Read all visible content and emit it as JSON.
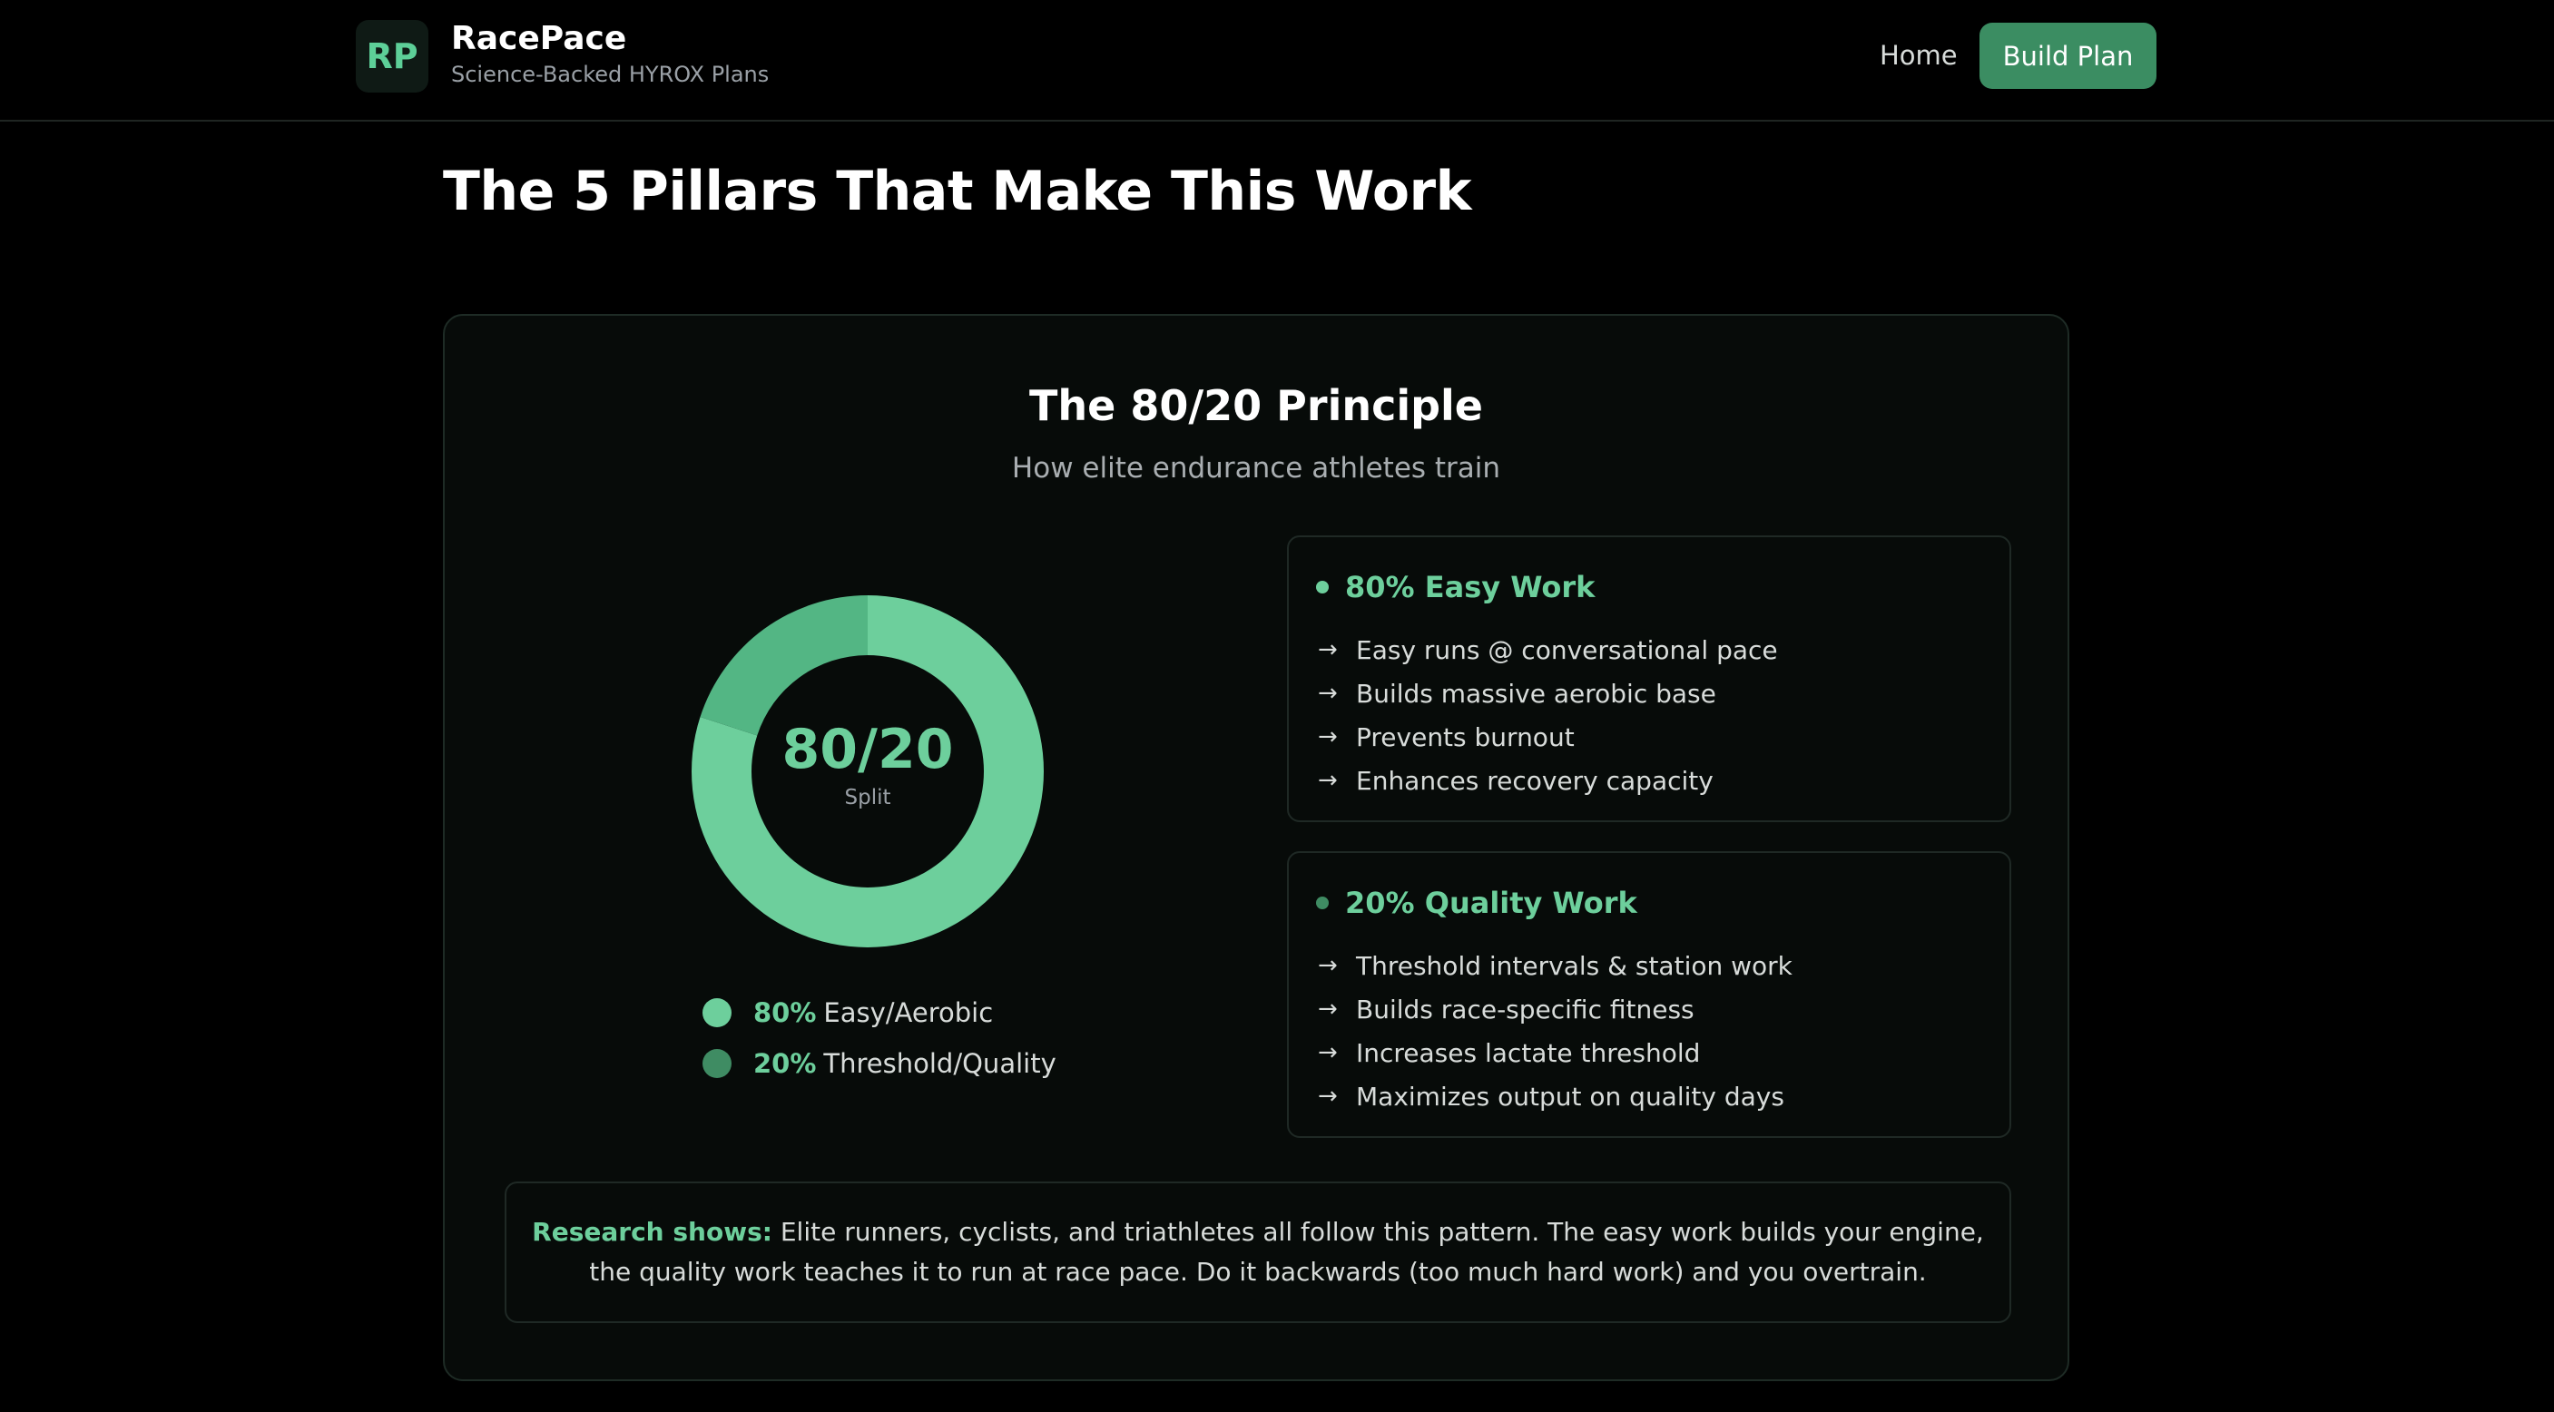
{
  "header": {
    "logo_text": "RP",
    "brand_name": "RacePace",
    "tagline": "Science-Backed HYROX Plans",
    "nav_home": "Home",
    "nav_build": "Build Plan"
  },
  "page_title": "The 5 Pillars That Make This Work",
  "principle_card": {
    "title": "The 80/20 Principle",
    "subtitle": "How elite endurance athletes train",
    "donut": {
      "center_value": "80/20",
      "center_label": "Split",
      "segments": [
        {
          "label": "Easy/Aerobic",
          "percent": 80,
          "color": "#6dcf9c"
        },
        {
          "label": "Threshold/Quality",
          "percent": 20,
          "color": "#53b684"
        }
      ]
    },
    "legend": [
      {
        "pct": "80%",
        "label": "Easy/Aerobic",
        "color": "#6dcf9c"
      },
      {
        "pct": "20%",
        "label": "Threshold/Quality",
        "color": "#3f8c63"
      }
    ],
    "easy_box": {
      "title": "80% Easy Work",
      "dot_color": "#6dcf9c",
      "items": [
        "Easy runs @ conversational pace",
        "Builds massive aerobic base",
        "Prevents burnout",
        "Enhances recovery capacity"
      ]
    },
    "quality_box": {
      "title": "20% Quality Work",
      "dot_color": "#3f8c63",
      "items": [
        "Threshold intervals & station work",
        "Builds race-specific fitness",
        "Increases lactate threshold",
        "Maximizes output on quality days"
      ]
    },
    "research": {
      "lead": "Research shows:",
      "text": "Elite runners, cyclists, and triathletes all follow this pattern. The easy work builds your engine, the quality work teaches it to run at race pace. Do it backwards (too much hard work) and you overtrain."
    }
  },
  "colors": {
    "accent": "#6dcf9c",
    "button": "#3b8d62",
    "background": "#000000",
    "card": "#070b09"
  },
  "icons": {
    "list_arrow": "arrow-right-icon"
  }
}
